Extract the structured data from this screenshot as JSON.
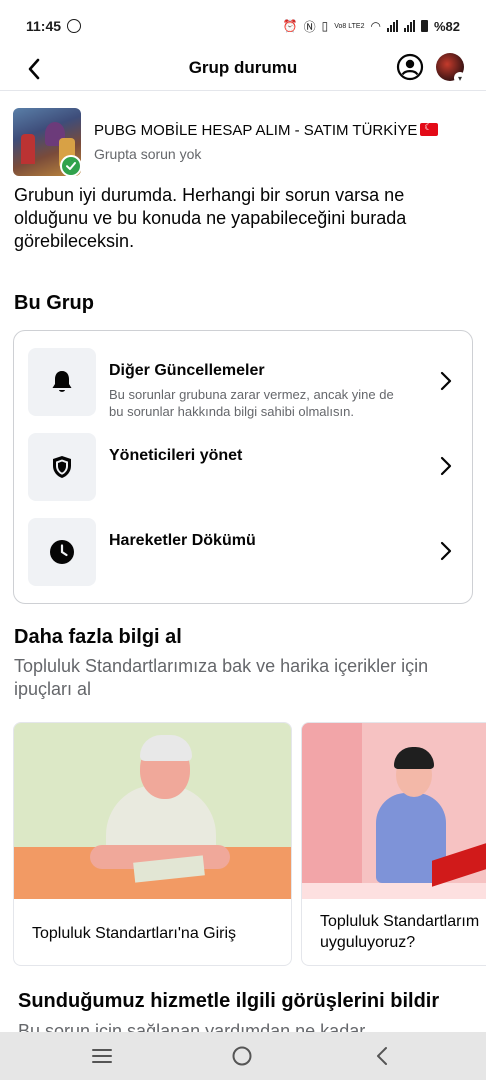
{
  "status_bar": {
    "time": "11:45",
    "network_label": "Vo8 LTE2",
    "battery": "%82"
  },
  "header": {
    "title": "Grup durumu"
  },
  "group": {
    "name": "PUBG MOBİLE HESAP ALIM - SATIM TÜRKİYE",
    "status": "Grupta sorun yok"
  },
  "intro": "Grubun iyi durumda. Herhangi bir sorun varsa ne olduğunu ve bu konuda ne yapabileceğini burada görebileceksin.",
  "this_group": {
    "title": "Bu Grup",
    "items": [
      {
        "icon": "bell-icon",
        "title": "Diğer Güncellemeler",
        "description": "Bu sorunlar grubuna zarar vermez, ancak yine de bu sorunlar hakkında bilgi sahibi olmalısın."
      },
      {
        "icon": "shield-icon",
        "title": "Yöneticileri yönet",
        "description": ""
      },
      {
        "icon": "clock-icon",
        "title": "Hareketler Dökümü",
        "description": ""
      }
    ]
  },
  "more_info": {
    "title": "Daha fazla bilgi al",
    "subtitle": "Topluluk Standartlarımıza bak ve harika içerikler için ipuçları al",
    "articles": [
      {
        "label": "Topluluk Standartları'na Giriş"
      },
      {
        "label_line1": "Topluluk Standartlarım",
        "label_line2": "uyguluyoruz?"
      }
    ]
  },
  "feedback": {
    "title": "Sunduğumuz hizmetle ilgili görüşlerini bildir",
    "subtitle": "Bu sorun için sağlanan yardımdan ne kadar"
  },
  "colors": {
    "accent_green": "#31a24c",
    "secondary_text": "#65676b",
    "card_border": "#ced0d4",
    "icon_bg": "#f0f2f5"
  }
}
